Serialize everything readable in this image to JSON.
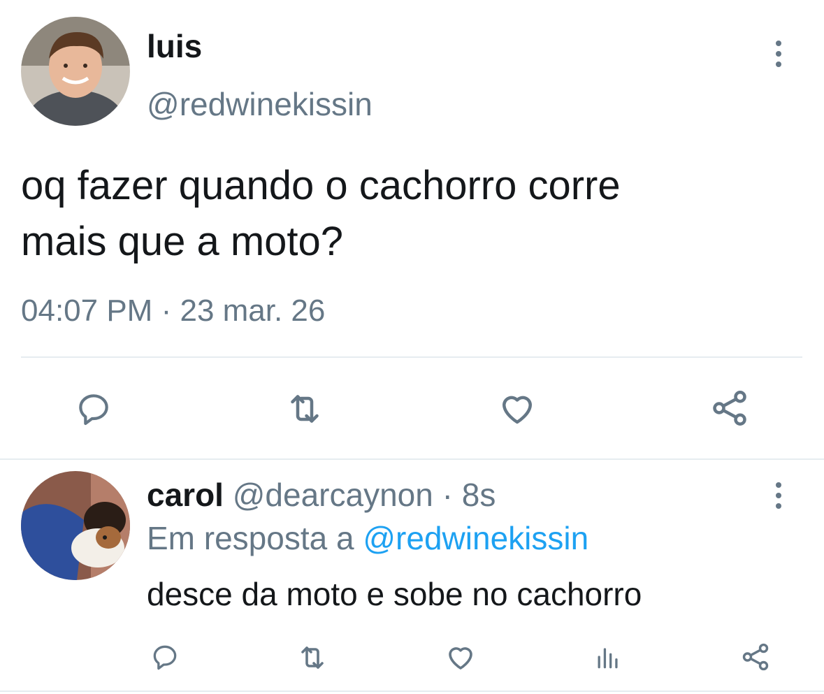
{
  "main_tweet": {
    "author_name": "luis",
    "handle": "@redwinekissin",
    "text_line1": "oq fazer quando o cachorro corre",
    "text_line2": "mais que a moto?",
    "time": "04:07 PM",
    "separator": "·",
    "date": "23 mar. 26",
    "actions": [
      "reply-icon",
      "retweet-icon",
      "like-icon",
      "share-icon"
    ]
  },
  "reply": {
    "author_name": "carol",
    "handle": "@dearcaynon",
    "separator": "·",
    "age": "8s",
    "reply_prefix": "Em resposta a",
    "reply_to": "@redwinekissin",
    "text": "desce da moto e sobe no cachorro",
    "actions": [
      "reply-icon",
      "retweet-icon",
      "like-icon",
      "analytics-icon",
      "share-icon"
    ]
  },
  "colors": {
    "text": "#14171a",
    "muted": "#657786",
    "link": "#1da1f2",
    "divider": "#e6ecf0"
  }
}
